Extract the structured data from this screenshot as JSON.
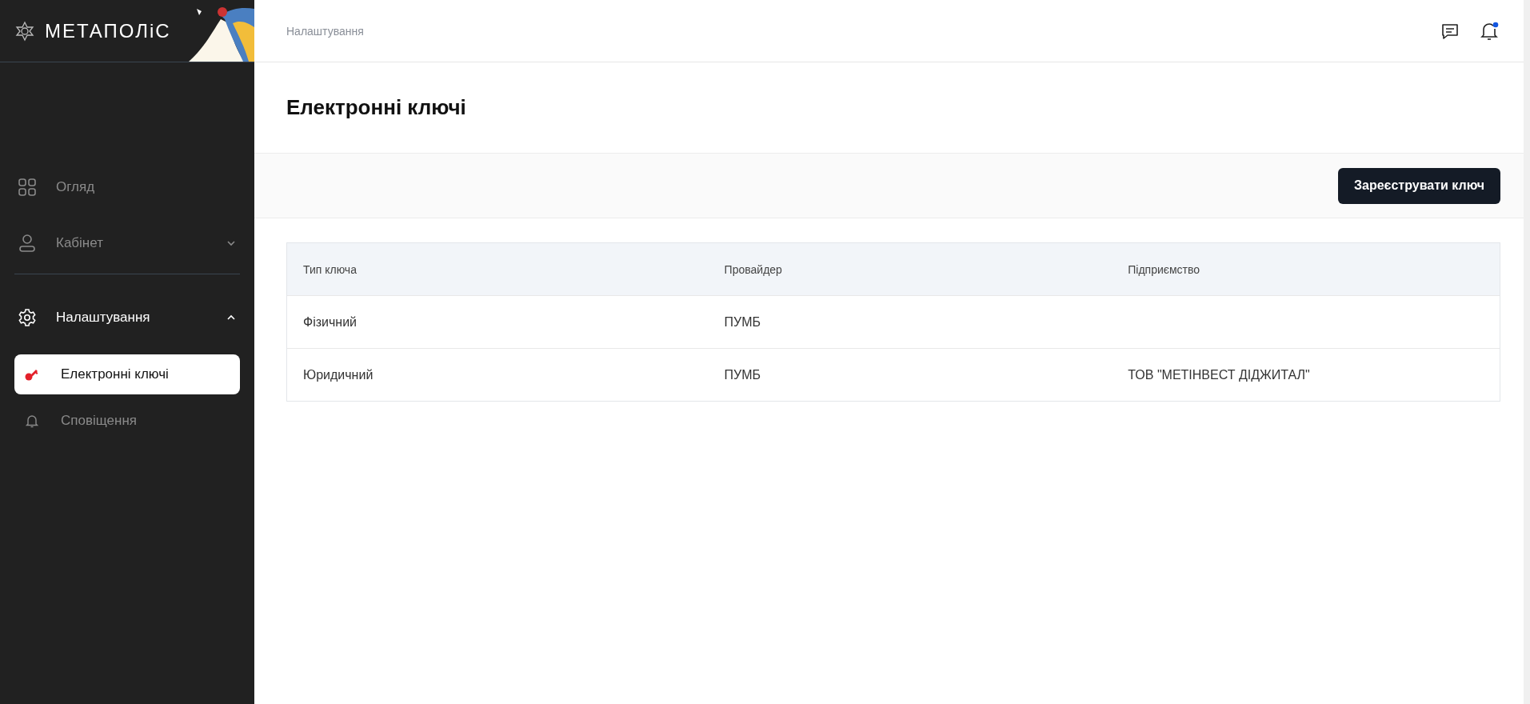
{
  "logo": {
    "text": "МЕТАПОЛіС"
  },
  "sidebar": {
    "items": [
      {
        "kind": "link",
        "label": "Огляд",
        "selected": false
      },
      {
        "kind": "group",
        "label": "Кабінет",
        "expanded": false,
        "selected": false
      },
      {
        "kind": "divider"
      },
      {
        "kind": "group",
        "label": "Налаштування",
        "expanded": true,
        "selected": false
      },
      {
        "kind": "sub",
        "label": "Електронні ключі",
        "selected": true
      },
      {
        "kind": "sub",
        "label": "Сповіщення",
        "selected": false
      }
    ]
  },
  "header": {
    "breadcrumb": "Налаштування",
    "notifications_unread": true
  },
  "page": {
    "title": "Електронні ключі",
    "action": "Зареєструвати ключ"
  },
  "table": {
    "columns": [
      "Тип ключа",
      "Провайдер",
      "Підприємство"
    ],
    "rows": [
      [
        "Фізичний",
        "ПУМБ",
        ""
      ],
      [
        "Юридичний",
        "ПУМБ",
        "ТОВ \"МЕТІНВЕСТ ДІДЖИТАЛ\""
      ]
    ]
  }
}
